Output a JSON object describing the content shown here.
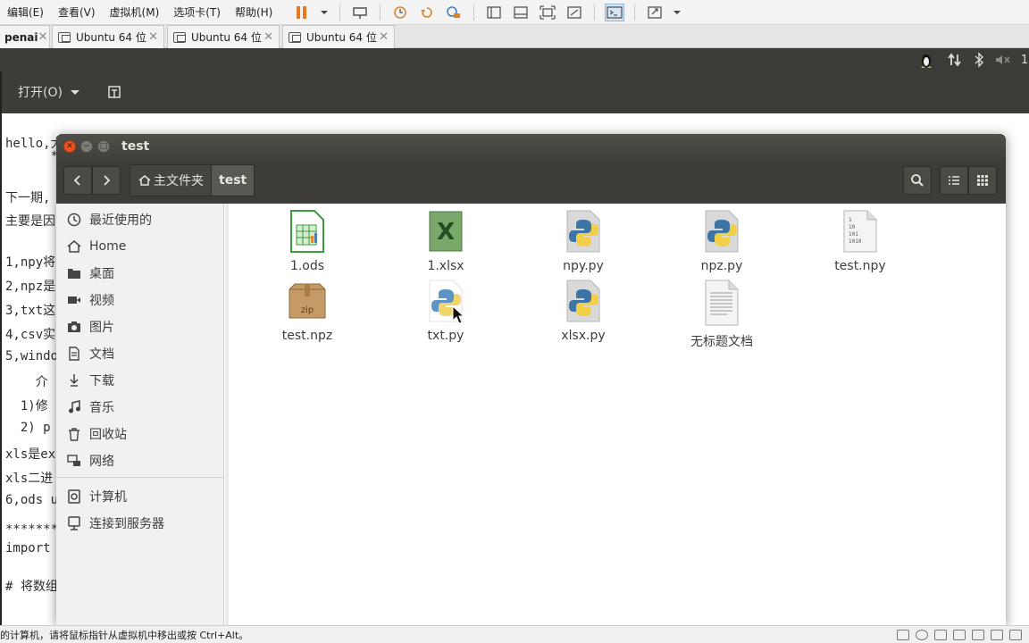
{
  "host_menu": [
    "编辑(E)",
    "查看(V)",
    "虚拟机(M)",
    "选项卡(T)",
    "帮助(H)"
  ],
  "host_tabs": [
    {
      "label": "penai"
    },
    {
      "label": "Ubuntu 64 位"
    },
    {
      "label": "Ubuntu 64 位"
    },
    {
      "label": "Ubuntu 64 位"
    }
  ],
  "gedit": {
    "open_label": "打开(O)",
    "lines": [
      "hello,大",
      "      *",
      "下一期,",
      "主要是因",
      "1,npy将",
      "2,npz是",
      "3,txt这",
      "4,csv实",
      "5,windo",
      "    介",
      "  1)修",
      "  2) p",
      "xls是ex",
      "xls二进",
      "6,ods u",
      "*******",
      "import ",
      "# 将数组"
    ]
  },
  "status_bar": {
    "text": "的计算机，请将鼠标指针从虚拟机中移出或按 Ctrl+Alt。"
  },
  "nautilus": {
    "title": "test",
    "breadcrumb": {
      "home": "主文件夹",
      "current": "test"
    },
    "sidebar": [
      {
        "label": "最近使用的",
        "icon": "clock-icon"
      },
      {
        "label": "Home",
        "icon": "home-icon"
      },
      {
        "label": "桌面",
        "icon": "folder-icon"
      },
      {
        "label": "视频",
        "icon": "video-icon"
      },
      {
        "label": "图片",
        "icon": "camera-icon"
      },
      {
        "label": "文档",
        "icon": "document-icon"
      },
      {
        "label": "下载",
        "icon": "download-icon"
      },
      {
        "label": "音乐",
        "icon": "music-icon"
      },
      {
        "label": "回收站",
        "icon": "trash-icon"
      },
      {
        "label": "网络",
        "icon": "network-icon"
      },
      {
        "label": "计算机",
        "icon": "computer-icon"
      },
      {
        "label": "连接到服务器",
        "icon": "server-icon"
      }
    ],
    "files": [
      {
        "name": "1.ods",
        "icon": "spreadsheet-ods-icon"
      },
      {
        "name": "1.xlsx",
        "icon": "excel-icon"
      },
      {
        "name": "npy.py",
        "icon": "python-icon"
      },
      {
        "name": "npz.py",
        "icon": "python-icon"
      },
      {
        "name": "test.npy",
        "icon": "binary-file-icon"
      },
      {
        "name": "test.npz",
        "icon": "zip-archive-icon"
      },
      {
        "name": "txt.py",
        "icon": "python-icon"
      },
      {
        "name": "xlsx.py",
        "icon": "python-icon"
      },
      {
        "name": "无标题文档",
        "icon": "text-file-icon"
      }
    ]
  },
  "colors": {
    "ubuntu_dark": "#3c3b37",
    "close_button": "#e9541f",
    "python_blue": "#3d74a8",
    "python_yellow": "#f2cf48",
    "ods_green": "#3b9a3b",
    "excel_green": "#2b7a3a"
  }
}
